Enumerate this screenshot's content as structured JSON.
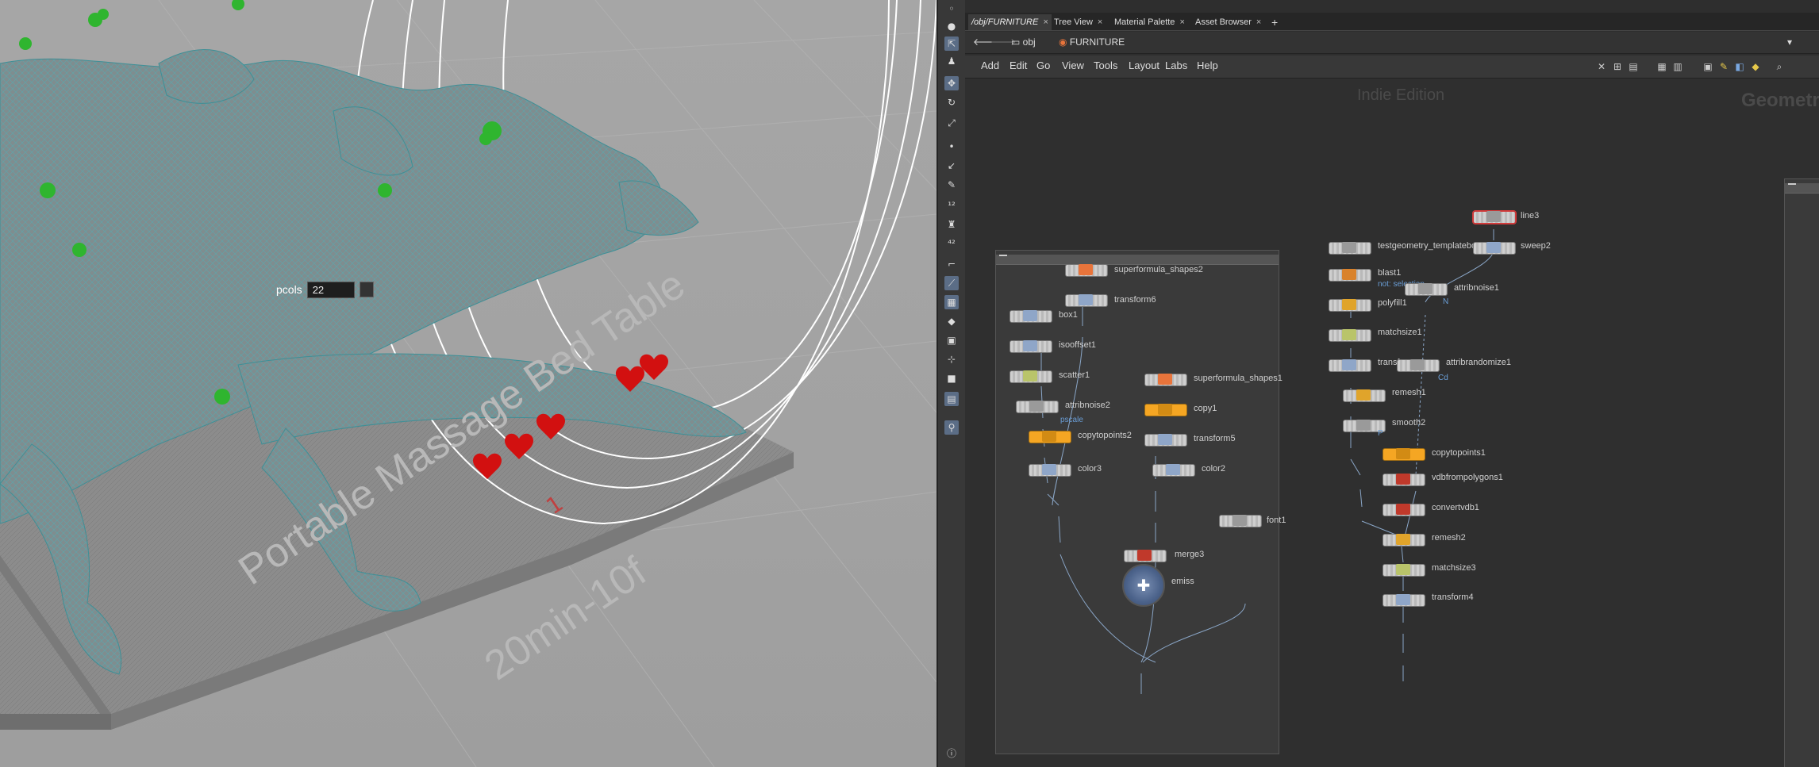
{
  "viewport": {
    "tooltip": {
      "label": "pcols",
      "value": "22"
    },
    "ground_text": {
      "line1": "Portable Massage Bed Table",
      "line2": "20min-10f"
    },
    "marker_text": "1"
  },
  "tabs": [
    {
      "label": "/obj/FURNITURE",
      "close": "×"
    },
    {
      "label": "Tree View",
      "close": "×"
    },
    {
      "label": "Material Palette",
      "close": "×"
    },
    {
      "label": "Asset Browser",
      "close": "×"
    },
    {
      "label": "+",
      "close": ""
    }
  ],
  "path": {
    "root": "obj",
    "current": "FURNITURE"
  },
  "menu": [
    "Add",
    "Edit",
    "Go",
    "View",
    "Tools",
    "Layout",
    "Labs",
    "Help"
  ],
  "watermarks": {
    "edition": "Indie Edition",
    "context": "Geometry"
  },
  "nodes_left": [
    {
      "name": "superformula_shapes2"
    },
    {
      "name": "transform6"
    },
    {
      "name": "box1"
    },
    {
      "name": "isooffset1"
    },
    {
      "name": "scatter1"
    },
    {
      "name": "attribnoise2",
      "attr": "pscale"
    },
    {
      "name": "copytopoints2"
    },
    {
      "name": "color3"
    },
    {
      "name": "superformula_shapes1"
    },
    {
      "name": "copy1"
    },
    {
      "name": "transform5"
    },
    {
      "name": "color2"
    },
    {
      "name": "font1"
    },
    {
      "name": "merge3"
    },
    {
      "name": "emiss"
    }
  ],
  "nodes_right": [
    {
      "name": "line3"
    },
    {
      "name": "testgeometry_templatebody1"
    },
    {
      "name": "sweep2"
    },
    {
      "name": "blast1",
      "attr": "not: selection"
    },
    {
      "name": "attribnoise1",
      "attr": "N"
    },
    {
      "name": "polyfill1"
    },
    {
      "name": "matchsize1"
    },
    {
      "name": "transform"
    },
    {
      "name": "attribrandomize1",
      "attr": "Cd"
    },
    {
      "name": "remesh1"
    },
    {
      "name": "smooth2",
      "attr": "P"
    },
    {
      "name": "copytopoints1"
    },
    {
      "name": "vdbfrompolygons1"
    },
    {
      "name": "convertvdb1"
    },
    {
      "name": "remesh2"
    },
    {
      "name": "matchsize3"
    },
    {
      "name": "transform4"
    }
  ]
}
